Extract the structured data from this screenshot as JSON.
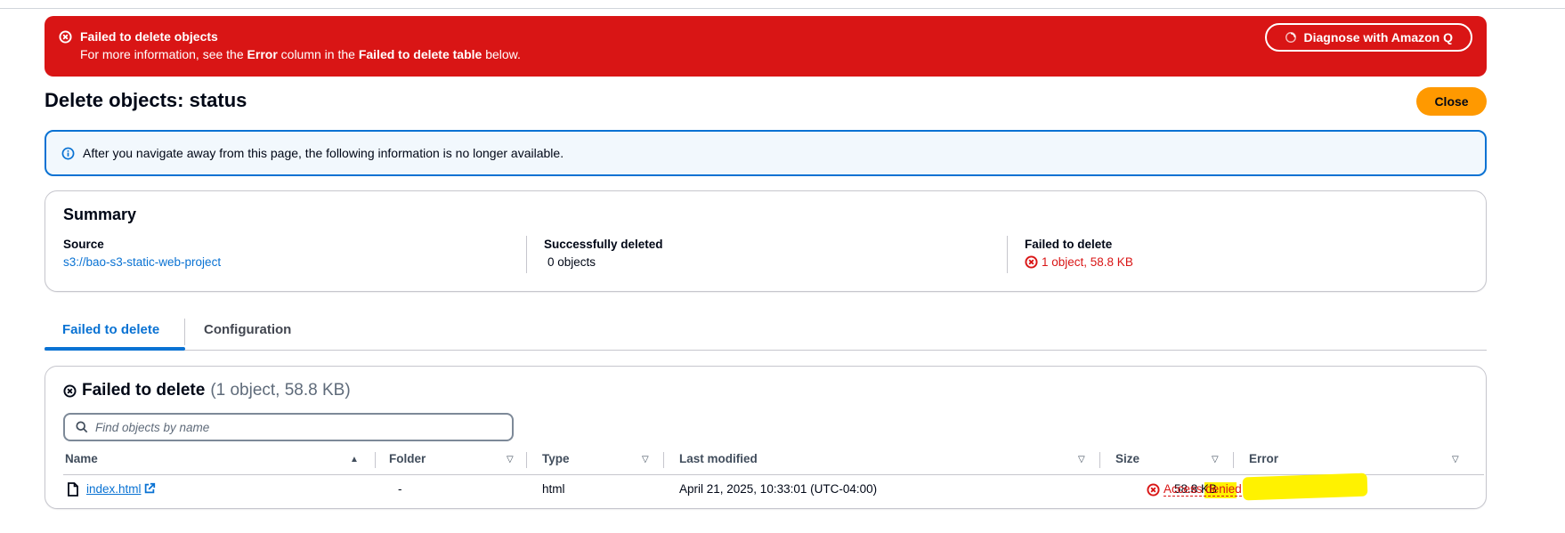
{
  "flash": {
    "title": "Failed to delete objects",
    "message_prefix": "For more information, see the ",
    "message_bold1": "Error",
    "message_mid": " column in the ",
    "message_bold2": "Failed to delete table",
    "message_suffix": " below.",
    "diagnose_label": "Diagnose with Amazon Q",
    "color": "#d91515"
  },
  "header": {
    "title": "Delete objects: status",
    "close_label": "Close"
  },
  "info": {
    "text": "After you navigate away from this page, the following information is no longer available."
  },
  "summary": {
    "title": "Summary",
    "source_label": "Source",
    "source_value": "s3://bao-s3-static-web-project",
    "success_label": "Successfully deleted",
    "success_value": "0 objects",
    "failed_label": "Failed to delete",
    "failed_value": "1 object, 58.8 KB"
  },
  "tabs": [
    {
      "label": "Failed to delete",
      "active": true
    },
    {
      "label": "Configuration",
      "active": false
    }
  ],
  "failed_table": {
    "title": "Failed to delete",
    "count": "(1 object, 58.8 KB)",
    "search_placeholder": "Find objects by name",
    "columns": [
      "Name",
      "Folder",
      "Type",
      "Last modified",
      "Size",
      "Error"
    ],
    "rows": [
      {
        "name": "index.html",
        "folder": "-",
        "type": "html",
        "last_modified": "April 21, 2025, 10:33:01 (UTC-04:00)",
        "size": "58.8 KB",
        "error": "Access denied"
      }
    ]
  },
  "colors": {
    "accent": "#0972d3",
    "error": "#d91515",
    "primary_button": "#ff9900",
    "highlight": "#fff200"
  }
}
